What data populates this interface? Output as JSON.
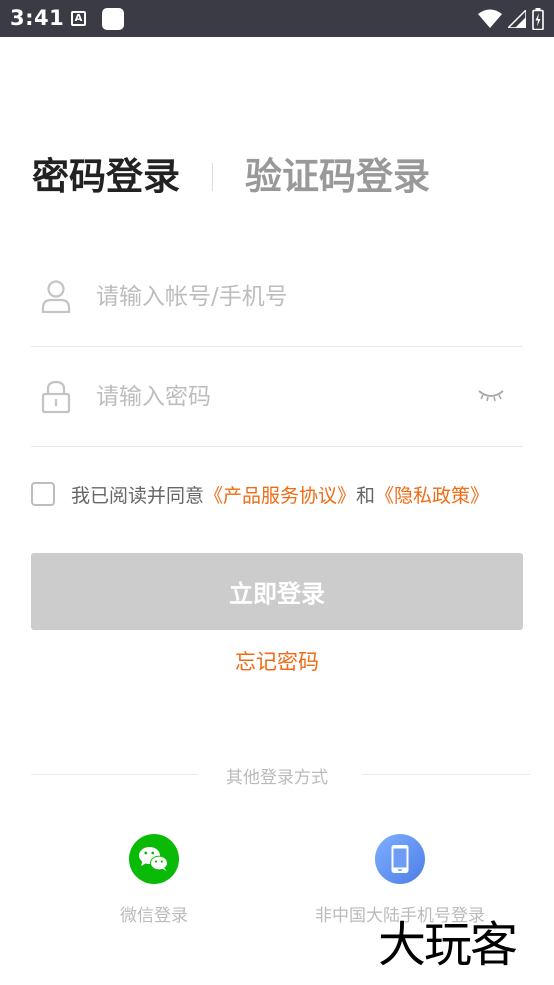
{
  "status_bar": {
    "time": "3:41",
    "notification_icon_letter": "A"
  },
  "tabs": [
    {
      "label": "密码登录",
      "active": true
    },
    {
      "label": "验证码登录",
      "active": false
    }
  ],
  "account_field": {
    "placeholder": "请输入帐号/手机号",
    "value": ""
  },
  "password_field": {
    "placeholder": "请输入密码",
    "value": ""
  },
  "agreement": {
    "prefix": "我已阅读并同意",
    "terms_link": "《产品服务协议》",
    "conjunction": "和",
    "privacy_link": "《隐私政策》",
    "checked": false
  },
  "login_button": {
    "label": "立即登录"
  },
  "forgot_password": {
    "label": "忘记密码"
  },
  "other_methods": {
    "label": "其他登录方式",
    "items": [
      {
        "label": "微信登录",
        "icon": "wechat-icon"
      },
      {
        "label": "非中国大陆手机号登录",
        "icon": "mobile-phone-icon"
      }
    ]
  },
  "watermark": {
    "text": "大玩客"
  },
  "colors": {
    "accent": "#f06b14",
    "button_disabled": "#cccccc",
    "wechat_green": "#09bb07",
    "phone_blue": "#5b8def",
    "status_bar": "#3b3b46"
  }
}
